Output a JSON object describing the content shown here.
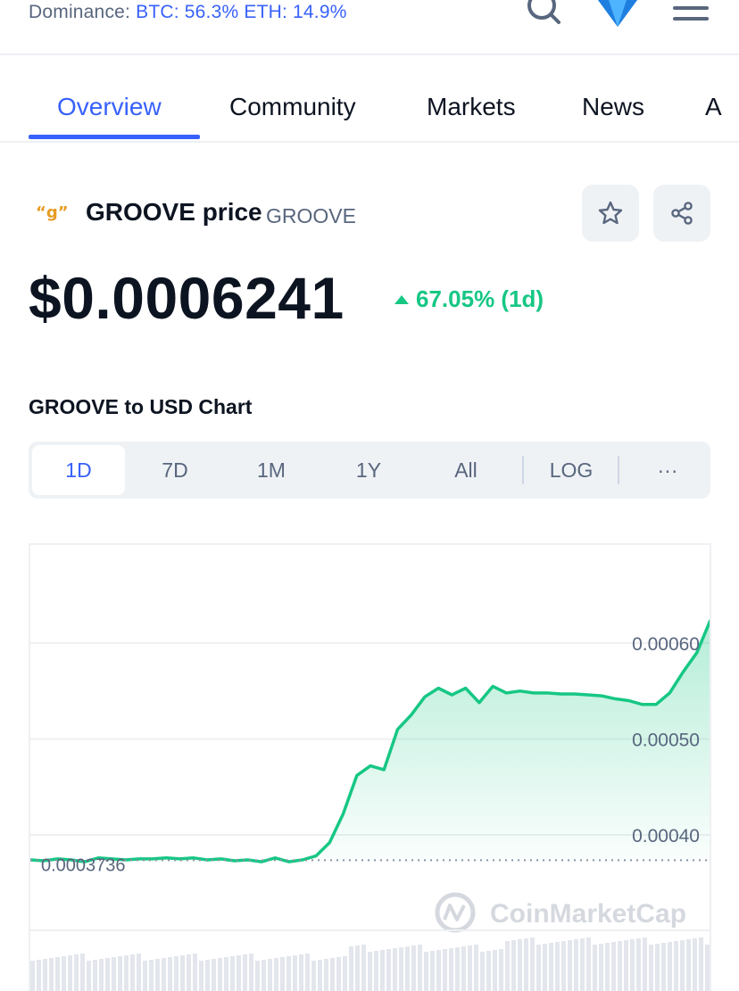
{
  "topbar": {
    "dominance_label": "Dominance:",
    "btc": "BTC: 56.3%",
    "eth": "ETH: 14.9%"
  },
  "tabs": [
    "Overview",
    "Community",
    "Markets",
    "News",
    "A"
  ],
  "coin": {
    "name": "GROOVE price",
    "symbol": "GROOVE",
    "logo_text": "“g”",
    "price": "$0.0006241",
    "change": "67.05% (1d)"
  },
  "chart_section": {
    "title": "GROOVE to USD Chart",
    "ranges": [
      "1D",
      "7D",
      "1M",
      "1Y",
      "All"
    ],
    "log_label": "LOG",
    "more_label": "···"
  },
  "colors": {
    "accent": "#3861fb",
    "up": "#16c784",
    "logo": "#e69c24"
  },
  "chart_data": {
    "type": "area",
    "y_ticks": [
      "0.00060",
      "0.00050",
      "0.00040"
    ],
    "y_tick_values": [
      0.0006,
      0.0005,
      0.0004
    ],
    "reference_label": "0.0003736",
    "reference_value": 0.0003736,
    "watermark": "CoinMarketCap",
    "x": [
      0,
      2,
      4,
      6,
      8,
      10,
      12,
      14,
      16,
      18,
      20,
      22,
      24,
      26,
      28,
      30,
      32,
      34,
      36,
      38,
      40,
      42,
      44,
      46,
      48,
      50,
      52,
      54,
      56,
      58,
      60,
      62,
      64,
      66,
      68,
      70,
      72,
      74,
      76,
      78,
      80,
      82,
      84,
      86,
      88,
      90,
      92,
      94,
      96,
      98,
      100
    ],
    "values": [
      0.000374,
      0.000373,
      0.000375,
      0.000374,
      0.000372,
      0.000376,
      0.000375,
      0.000374,
      0.000375,
      0.000375,
      0.000376,
      0.000375,
      0.000376,
      0.000374,
      0.000375,
      0.000373,
      0.000374,
      0.000372,
      0.000376,
      0.000372,
      0.000374,
      0.000378,
      0.000392,
      0.000422,
      0.000462,
      0.000472,
      0.000468,
      0.00051,
      0.000525,
      0.000544,
      0.000553,
      0.000546,
      0.000553,
      0.000538,
      0.000555,
      0.000548,
      0.00055,
      0.000548,
      0.000548,
      0.000547,
      0.000547,
      0.000546,
      0.000545,
      0.000542,
      0.00054,
      0.000536,
      0.000536,
      0.000548,
      0.00057,
      0.00059,
      0.000624
    ]
  }
}
